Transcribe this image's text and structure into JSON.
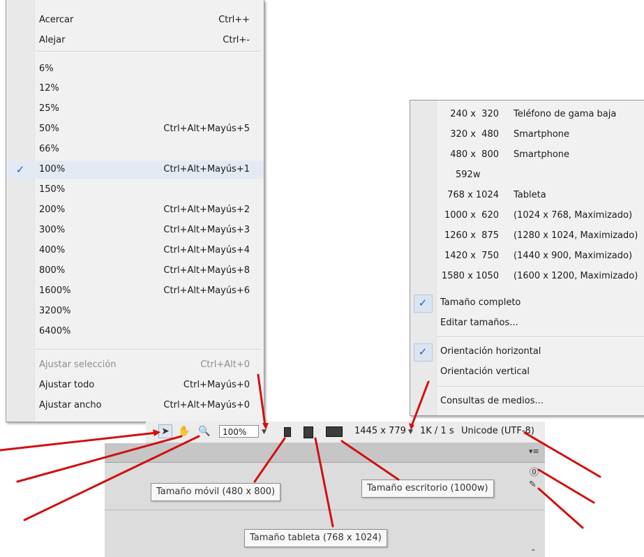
{
  "zoom_menu": {
    "items": [
      {
        "label": "Acercar",
        "shortcut": "Ctrl++"
      },
      {
        "label": "Alejar",
        "shortcut": "Ctrl+-"
      },
      {
        "label": "6%",
        "shortcut": ""
      },
      {
        "label": "12%",
        "shortcut": ""
      },
      {
        "label": "25%",
        "shortcut": ""
      },
      {
        "label": "50%",
        "shortcut": "Ctrl+Alt+Mayús+5"
      },
      {
        "label": "66%",
        "shortcut": ""
      },
      {
        "label": "100%",
        "shortcut": "Ctrl+Alt+Mayús+1",
        "checked": true
      },
      {
        "label": "150%",
        "shortcut": ""
      },
      {
        "label": "200%",
        "shortcut": "Ctrl+Alt+Mayús+2"
      },
      {
        "label": "300%",
        "shortcut": "Ctrl+Alt+Mayús+3"
      },
      {
        "label": "400%",
        "shortcut": "Ctrl+Alt+Mayús+4"
      },
      {
        "label": "800%",
        "shortcut": "Ctrl+Alt+Mayús+8"
      },
      {
        "label": "1600%",
        "shortcut": "Ctrl+Alt+Mayús+6"
      },
      {
        "label": "3200%",
        "shortcut": ""
      },
      {
        "label": "6400%",
        "shortcut": ""
      },
      {
        "label": "Ajustar selección",
        "shortcut": "Ctrl+Alt+0",
        "disabled": true
      },
      {
        "label": "Ajustar todo",
        "shortcut": "Ctrl+Mayús+0"
      },
      {
        "label": "Ajustar ancho",
        "shortcut": "Ctrl+Alt+Mayús+0"
      }
    ],
    "check_glyph": "✓"
  },
  "size_menu": {
    "sizes": [
      {
        "dim": "240 x  320",
        "desc": "Teléfono de gama baja"
      },
      {
        "dim": "320 x  480",
        "desc": "Smartphone"
      },
      {
        "dim": "480 x  800",
        "desc": "Smartphone"
      },
      {
        "dim": "592w",
        "desc": ""
      },
      {
        "dim": "768 x 1024",
        "desc": "Tableta"
      },
      {
        "dim": "1000 x  620",
        "desc": "(1024 x 768, Maximizado)"
      },
      {
        "dim": "1260 x  875",
        "desc": "(1280 x 1024, Maximizado)"
      },
      {
        "dim": "1420 x  750",
        "desc": "(1440 x 900, Maximizado)"
      },
      {
        "dim": "1580 x 1050",
        "desc": "(1600 x 1200, Maximizado)"
      }
    ],
    "full_size": "Tamaño completo",
    "edit_sizes": "Editar tamaños...",
    "orientation_h": "Orientación horizontal",
    "orientation_v": "Orientación vertical",
    "media_queries": "Consultas de medios..."
  },
  "status_bar": {
    "zoom_value": "100%",
    "window_size": "1445 x 779",
    "download": "1K / 1 s",
    "encoding": "Unicode (UTF-8)"
  },
  "tooltips": {
    "mobile": "Tamaño móvil (480 x 800)",
    "tablet": "Tamaño tableta (768 x 1024)",
    "desktop": "Tamaño escritorio (1000w)"
  },
  "colors": {
    "check": "#1a5fc4",
    "arrow": "#d01010",
    "menu_bg": "#f1f1f1"
  }
}
